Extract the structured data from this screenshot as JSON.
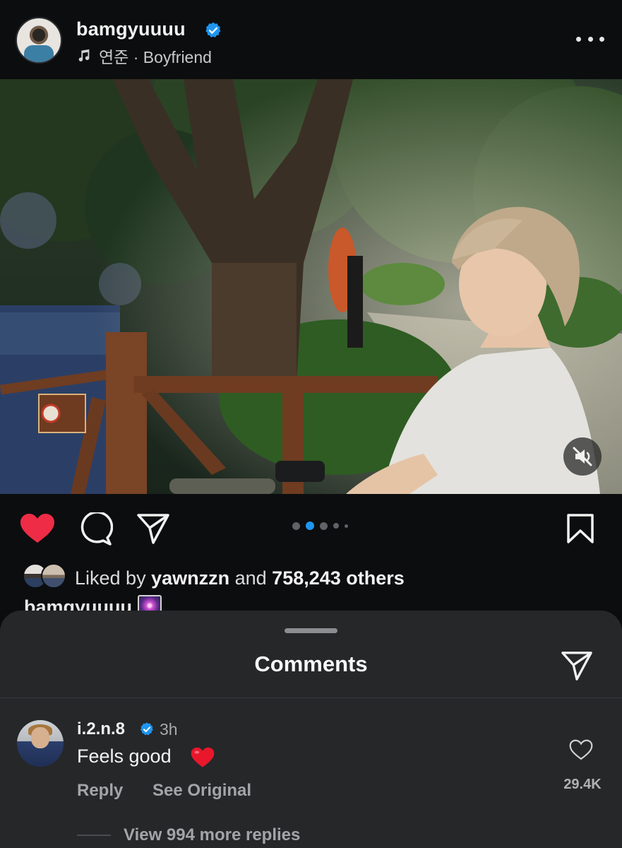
{
  "header": {
    "username": "bamgyuuuu",
    "music": "연준 · Boyfriend"
  },
  "post": {
    "image_description_icon": "photo",
    "carousel": {
      "count": 5,
      "active_index": 1
    }
  },
  "actions": {
    "liked": true,
    "like_icon": "heart-icon",
    "comment_icon": "comment-icon",
    "share_icon": "send-icon",
    "save_icon": "bookmark-icon"
  },
  "likes": {
    "prefix": "Liked by ",
    "user": "yawnzzn",
    "middle": " and ",
    "count": "758,243 others"
  },
  "caption": {
    "username": "bamgyuuuu"
  },
  "comments_sheet": {
    "title": "Comments",
    "comments": [
      {
        "username": "i.2.n.8",
        "time": "3h",
        "text": "Feels good",
        "reply_label": "Reply",
        "see_original_label": "See Original",
        "like_count": "29.4K",
        "more_replies": "View 994 more replies"
      }
    ]
  },
  "colors": {
    "accent_blue": "#1e95f0",
    "like_red": "#ee2c46",
    "sheet_bg": "#262729"
  }
}
